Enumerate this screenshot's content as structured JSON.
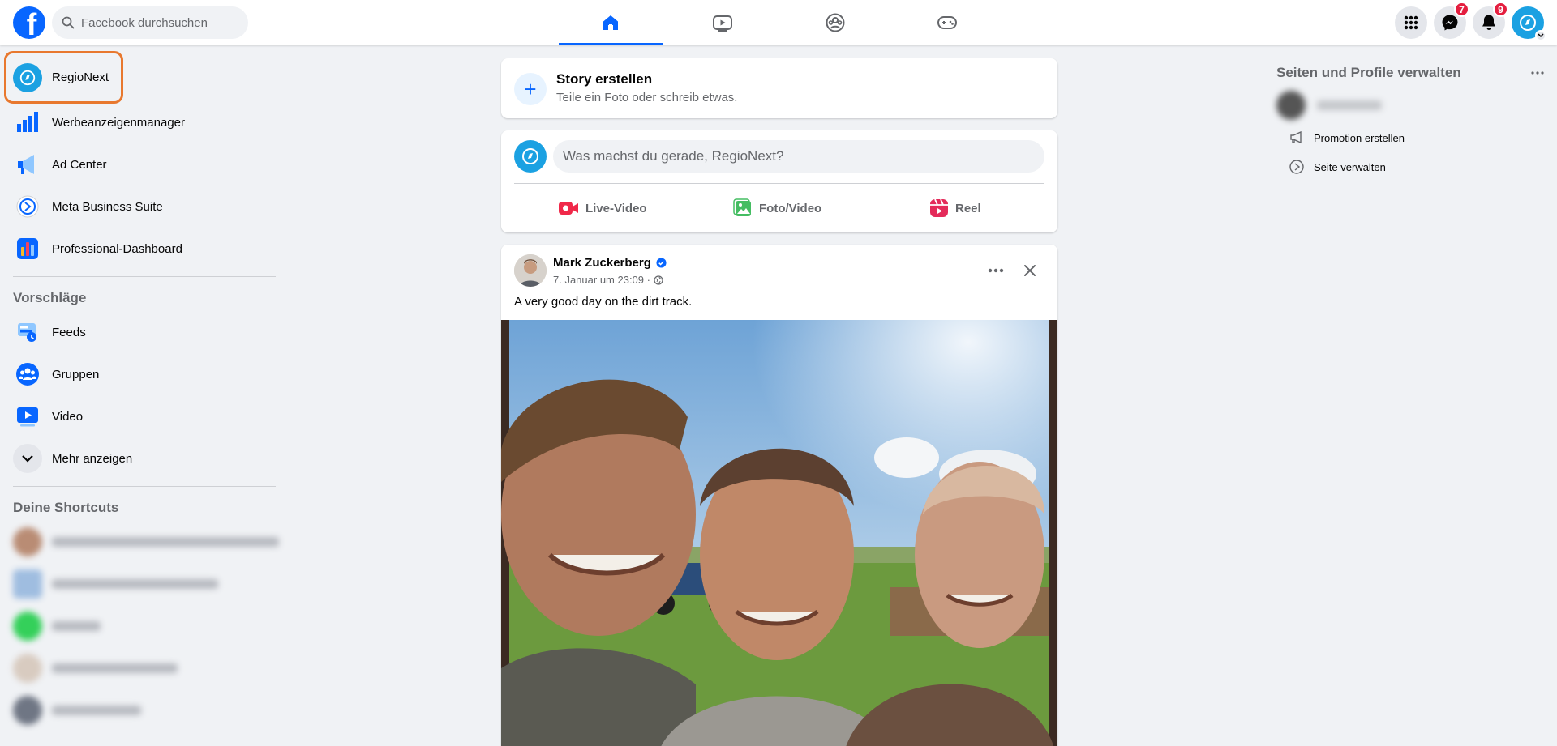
{
  "topbar": {
    "logo": "facebook-logo",
    "search_placeholder": "Facebook durchsuchen",
    "tabs": [
      {
        "icon": "home-icon",
        "active": true
      },
      {
        "icon": "video-icon",
        "active": false
      },
      {
        "icon": "groups-icon",
        "active": false
      },
      {
        "icon": "gaming-icon",
        "active": false
      }
    ],
    "menu_icon": "grid-menu-icon",
    "messenger_badge": "7",
    "notifications_badge": "9",
    "accent_color": "#0866ff"
  },
  "sidebar": {
    "items": [
      {
        "label": "RegioNext",
        "icon": "regionext-avatar"
      },
      {
        "label": "Werbeanzeigenmanager",
        "icon": "ads-manager-icon"
      },
      {
        "label": "Ad Center",
        "icon": "megaphone-icon"
      },
      {
        "label": "Meta Business Suite",
        "icon": "business-suite-icon"
      },
      {
        "label": "Professional-Dashboard",
        "icon": "dashboard-icon"
      }
    ],
    "suggestions_title": "Vorschläge",
    "suggestions": [
      {
        "label": "Feeds",
        "icon": "feeds-icon"
      },
      {
        "label": "Gruppen",
        "icon": "groups-icon"
      },
      {
        "label": "Video",
        "icon": "video-icon"
      },
      {
        "label": "Mehr anzeigen",
        "icon": "chevron-down-icon"
      }
    ],
    "shortcuts_title": "Deine Shortcuts",
    "highlight_color": "#e8782e"
  },
  "story": {
    "title": "Story erstellen",
    "subtitle": "Teile ein Foto oder schreib etwas."
  },
  "composer": {
    "placeholder": "Was machst du gerade, RegioNext?",
    "actions": [
      {
        "label": "Live-Video",
        "icon": "live-video-icon"
      },
      {
        "label": "Foto/Video",
        "icon": "photo-icon"
      },
      {
        "label": "Reel",
        "icon": "reel-icon"
      }
    ]
  },
  "post": {
    "author": "Mark Zuckerberg",
    "verified": true,
    "timestamp": "7. Januar um 23:09 ·",
    "text": "A very good day on the dirt track."
  },
  "right": {
    "title": "Seiten und Profile verwalten",
    "items": [
      {
        "label": "Promotion erstellen",
        "icon": "megaphone-outline-icon"
      },
      {
        "label": "Seite verwalten",
        "icon": "manage-page-icon"
      }
    ]
  }
}
